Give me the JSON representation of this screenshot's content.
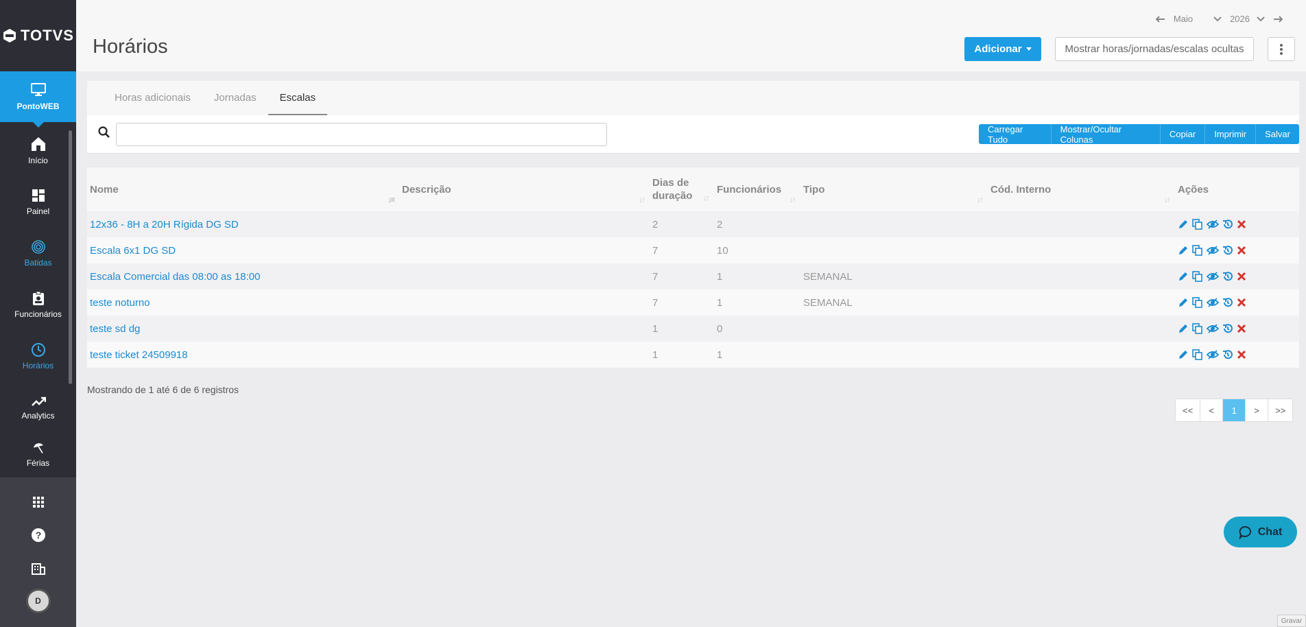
{
  "sidebar": {
    "logo": "TOTVS",
    "top_item": "PontoWEB",
    "items": [
      {
        "label": "Início",
        "icon": "home-icon"
      },
      {
        "label": "Painel",
        "icon": "dashboard-icon"
      },
      {
        "label": "Batidas",
        "icon": "fingerprint-icon"
      },
      {
        "label": "Funcionários",
        "icon": "badge-icon"
      },
      {
        "label": "Horários",
        "icon": "clock-icon"
      },
      {
        "label": "Analytics",
        "icon": "trending-up-icon"
      },
      {
        "label": "Férias",
        "icon": "umbrella-icon"
      }
    ],
    "avatar": "D"
  },
  "header": {
    "title": "Horários",
    "month": "Maio",
    "year": "2026",
    "add_button": "Adicionar",
    "hidden_button": "Mostrar horas/jornadas/escalas ocultas"
  },
  "tabs": [
    "Horas adicionais",
    "Jornadas",
    "Escalas"
  ],
  "active_tab": "Escalas",
  "search": {
    "value": "",
    "placeholder": ""
  },
  "toolbar": [
    "Carregar Tudo",
    "Mostrar/Ocultar Colunas",
    "Copiar",
    "Imprimir",
    "Salvar"
  ],
  "table": {
    "headers": [
      "Nome",
      "Descrição",
      "Dias de duração",
      "Funcionários",
      "Tipo",
      "Cód. Interno",
      "Ações"
    ],
    "rows": [
      {
        "nome": "12x36 - 8H a 20H Rígida DG SD",
        "descricao": "",
        "dias": "2",
        "funcionarios": "2",
        "tipo": "",
        "cod": ""
      },
      {
        "nome": "Escala 6x1 DG SD",
        "descricao": "",
        "dias": "7",
        "funcionarios": "10",
        "tipo": "",
        "cod": ""
      },
      {
        "nome": "Escala Comercial das 08:00 as 18:00",
        "descricao": "",
        "dias": "7",
        "funcionarios": "1",
        "tipo": "SEMANAL",
        "cod": ""
      },
      {
        "nome": "teste noturno",
        "descricao": "",
        "dias": "7",
        "funcionarios": "1",
        "tipo": "SEMANAL",
        "cod": ""
      },
      {
        "nome": "teste sd dg",
        "descricao": "",
        "dias": "1",
        "funcionarios": "0",
        "tipo": "",
        "cod": ""
      },
      {
        "nome": "teste ticket 24509918",
        "descricao": "",
        "dias": "1",
        "funcionarios": "1",
        "tipo": "",
        "cod": ""
      }
    ]
  },
  "info": "Mostrando de 1 até 6 de 6 registros",
  "pager": [
    "<<",
    "<",
    "1",
    ">",
    ">>"
  ],
  "chat": "Chat",
  "gravar": "Gravar",
  "colors": {
    "accent": "#1b9ce3",
    "sidebar": "#2d2e35",
    "delete": "#d9342b"
  }
}
